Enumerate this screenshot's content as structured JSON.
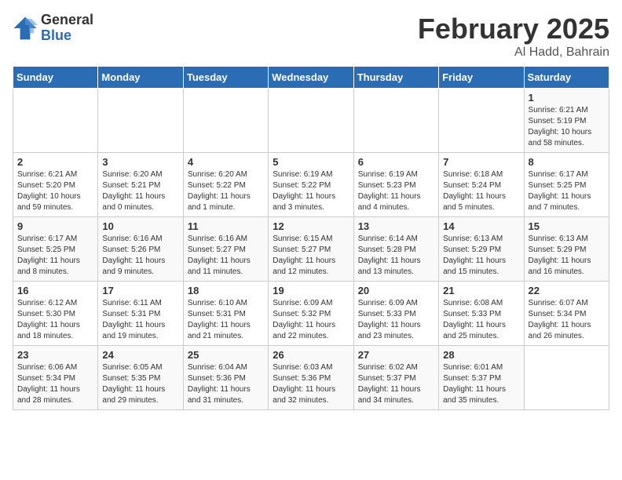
{
  "logo": {
    "general": "General",
    "blue": "Blue"
  },
  "title": "February 2025",
  "subtitle": "Al Hadd, Bahrain",
  "days_of_week": [
    "Sunday",
    "Monday",
    "Tuesday",
    "Wednesday",
    "Thursday",
    "Friday",
    "Saturday"
  ],
  "weeks": [
    [
      {
        "day": "",
        "info": ""
      },
      {
        "day": "",
        "info": ""
      },
      {
        "day": "",
        "info": ""
      },
      {
        "day": "",
        "info": ""
      },
      {
        "day": "",
        "info": ""
      },
      {
        "day": "",
        "info": ""
      },
      {
        "day": "1",
        "info": "Sunrise: 6:21 AM\nSunset: 5:19 PM\nDaylight: 10 hours\nand 58 minutes."
      }
    ],
    [
      {
        "day": "2",
        "info": "Sunrise: 6:21 AM\nSunset: 5:20 PM\nDaylight: 10 hours\nand 59 minutes."
      },
      {
        "day": "3",
        "info": "Sunrise: 6:20 AM\nSunset: 5:21 PM\nDaylight: 11 hours\nand 0 minutes."
      },
      {
        "day": "4",
        "info": "Sunrise: 6:20 AM\nSunset: 5:22 PM\nDaylight: 11 hours\nand 1 minute."
      },
      {
        "day": "5",
        "info": "Sunrise: 6:19 AM\nSunset: 5:22 PM\nDaylight: 11 hours\nand 3 minutes."
      },
      {
        "day": "6",
        "info": "Sunrise: 6:19 AM\nSunset: 5:23 PM\nDaylight: 11 hours\nand 4 minutes."
      },
      {
        "day": "7",
        "info": "Sunrise: 6:18 AM\nSunset: 5:24 PM\nDaylight: 11 hours\nand 5 minutes."
      },
      {
        "day": "8",
        "info": "Sunrise: 6:17 AM\nSunset: 5:25 PM\nDaylight: 11 hours\nand 7 minutes."
      }
    ],
    [
      {
        "day": "9",
        "info": "Sunrise: 6:17 AM\nSunset: 5:25 PM\nDaylight: 11 hours\nand 8 minutes."
      },
      {
        "day": "10",
        "info": "Sunrise: 6:16 AM\nSunset: 5:26 PM\nDaylight: 11 hours\nand 9 minutes."
      },
      {
        "day": "11",
        "info": "Sunrise: 6:16 AM\nSunset: 5:27 PM\nDaylight: 11 hours\nand 11 minutes."
      },
      {
        "day": "12",
        "info": "Sunrise: 6:15 AM\nSunset: 5:27 PM\nDaylight: 11 hours\nand 12 minutes."
      },
      {
        "day": "13",
        "info": "Sunrise: 6:14 AM\nSunset: 5:28 PM\nDaylight: 11 hours\nand 13 minutes."
      },
      {
        "day": "14",
        "info": "Sunrise: 6:13 AM\nSunset: 5:29 PM\nDaylight: 11 hours\nand 15 minutes."
      },
      {
        "day": "15",
        "info": "Sunrise: 6:13 AM\nSunset: 5:29 PM\nDaylight: 11 hours\nand 16 minutes."
      }
    ],
    [
      {
        "day": "16",
        "info": "Sunrise: 6:12 AM\nSunset: 5:30 PM\nDaylight: 11 hours\nand 18 minutes."
      },
      {
        "day": "17",
        "info": "Sunrise: 6:11 AM\nSunset: 5:31 PM\nDaylight: 11 hours\nand 19 minutes."
      },
      {
        "day": "18",
        "info": "Sunrise: 6:10 AM\nSunset: 5:31 PM\nDaylight: 11 hours\nand 21 minutes."
      },
      {
        "day": "19",
        "info": "Sunrise: 6:09 AM\nSunset: 5:32 PM\nDaylight: 11 hours\nand 22 minutes."
      },
      {
        "day": "20",
        "info": "Sunrise: 6:09 AM\nSunset: 5:33 PM\nDaylight: 11 hours\nand 23 minutes."
      },
      {
        "day": "21",
        "info": "Sunrise: 6:08 AM\nSunset: 5:33 PM\nDaylight: 11 hours\nand 25 minutes."
      },
      {
        "day": "22",
        "info": "Sunrise: 6:07 AM\nSunset: 5:34 PM\nDaylight: 11 hours\nand 26 minutes."
      }
    ],
    [
      {
        "day": "23",
        "info": "Sunrise: 6:06 AM\nSunset: 5:34 PM\nDaylight: 11 hours\nand 28 minutes."
      },
      {
        "day": "24",
        "info": "Sunrise: 6:05 AM\nSunset: 5:35 PM\nDaylight: 11 hours\nand 29 minutes."
      },
      {
        "day": "25",
        "info": "Sunrise: 6:04 AM\nSunset: 5:36 PM\nDaylight: 11 hours\nand 31 minutes."
      },
      {
        "day": "26",
        "info": "Sunrise: 6:03 AM\nSunset: 5:36 PM\nDaylight: 11 hours\nand 32 minutes."
      },
      {
        "day": "27",
        "info": "Sunrise: 6:02 AM\nSunset: 5:37 PM\nDaylight: 11 hours\nand 34 minutes."
      },
      {
        "day": "28",
        "info": "Sunrise: 6:01 AM\nSunset: 5:37 PM\nDaylight: 11 hours\nand 35 minutes."
      },
      {
        "day": "",
        "info": ""
      }
    ]
  ]
}
